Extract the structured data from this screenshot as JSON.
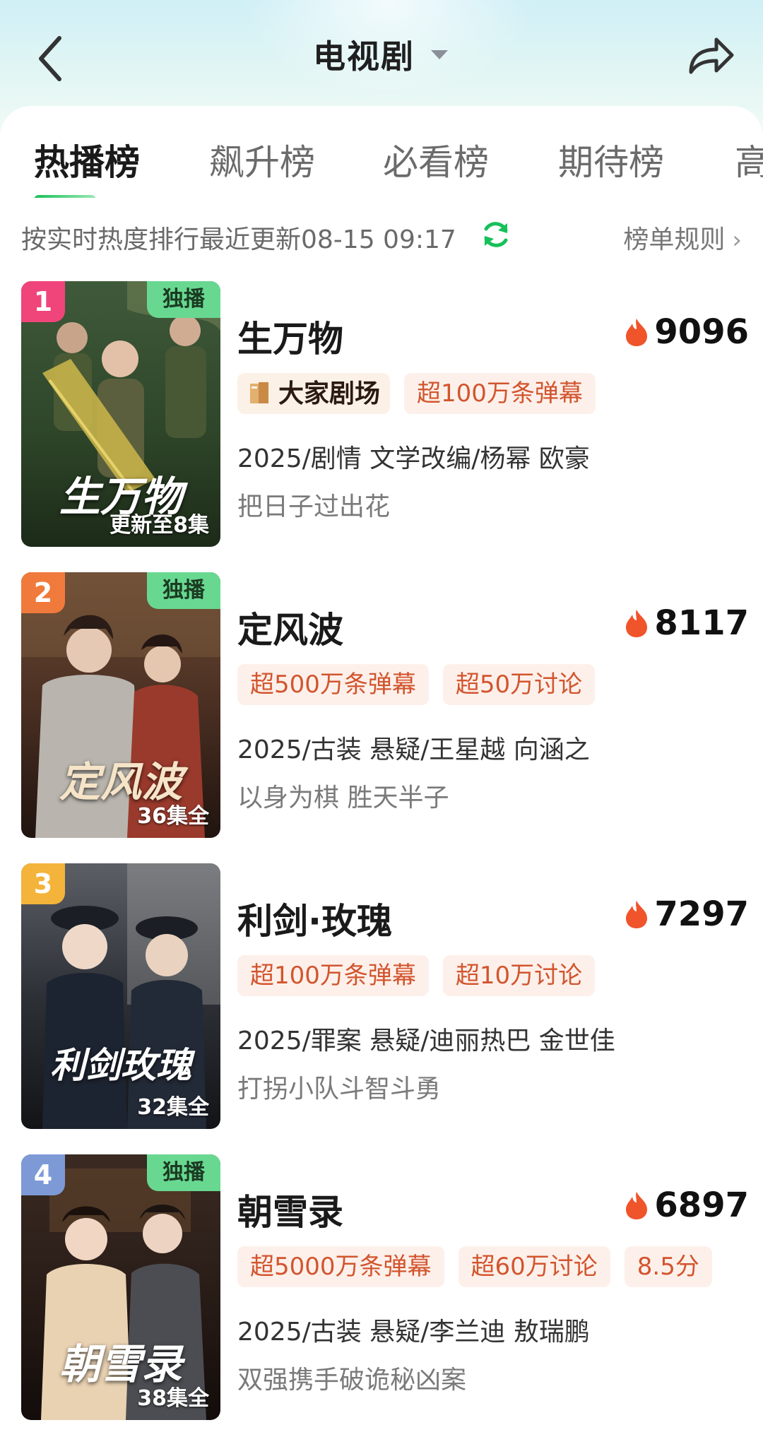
{
  "header": {
    "title": "电视剧",
    "back_icon": "chevron-left-icon",
    "share_icon": "share-arrow-icon",
    "dropdown_icon": "caret-down-icon"
  },
  "tabs": [
    {
      "label": "热播榜",
      "active": true
    },
    {
      "label": "飙升榜",
      "active": false
    },
    {
      "label": "必看榜",
      "active": false
    },
    {
      "label": "期待榜",
      "active": false
    },
    {
      "label": "高",
      "active": false
    }
  ],
  "info": {
    "update_text": "按实时热度排行最近更新08-15 09:17",
    "rules_label": "榜单规则",
    "rules_chevron": "›"
  },
  "colors": {
    "accent_green": "#17c05a",
    "tag_text": "#d2552e",
    "tag_bg": "#fdf0ea",
    "heat_flame": "#f0542b",
    "rank1": "#f0457a",
    "rank2": "#f07a3c",
    "rank3": "#f4b33a",
    "rank4": "#7d9ad6"
  },
  "items": [
    {
      "rank": "1",
      "exclusive": "独播",
      "poster_title": "生万物",
      "episodes": "更新至8集",
      "title": "生万物",
      "heat": "9096",
      "theater_tag": "大家剧场",
      "tags": [
        "超100万条弹幕"
      ],
      "meta": "2025/剧情 文学改编/杨幂 欧豪",
      "slogan": "把日子过出花"
    },
    {
      "rank": "2",
      "exclusive": "独播",
      "poster_title": "定风波",
      "episodes": "36集全",
      "title": "定风波",
      "heat": "8117",
      "tags": [
        "超500万条弹幕",
        "超50万讨论"
      ],
      "meta": "2025/古装 悬疑/王星越 向涵之",
      "slogan": "以身为棋 胜天半子"
    },
    {
      "rank": "3",
      "poster_title": "利剑玫瑰",
      "episodes": "32集全",
      "title": "利剑·玫瑰",
      "heat": "7297",
      "tags": [
        "超100万条弹幕",
        "超10万讨论"
      ],
      "meta": "2025/罪案 悬疑/迪丽热巴 金世佳",
      "slogan": "打拐小队斗智斗勇"
    },
    {
      "rank": "4",
      "exclusive": "独播",
      "poster_title": "朝雪录",
      "episodes": "38集全",
      "title": "朝雪录",
      "heat": "6897",
      "tags": [
        "超5000万条弹幕",
        "超60万讨论",
        "8.5分"
      ],
      "meta": "2025/古装 悬疑/李兰迪 敖瑞鹏",
      "slogan": "双强携手破诡秘凶案"
    }
  ]
}
